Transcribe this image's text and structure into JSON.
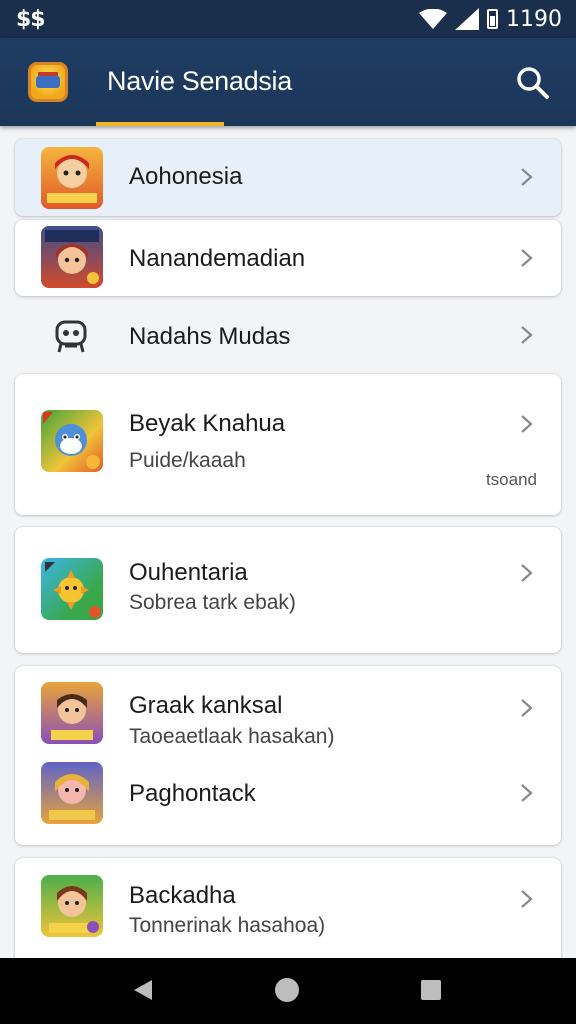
{
  "status_bar": {
    "left_icons": "$$",
    "time": "1190",
    "icons": [
      "wifi-icon",
      "signal-icon",
      "battery-icon"
    ]
  },
  "app_bar": {
    "title": "Navie Senadsia",
    "logo": "game-logo-icon",
    "search": "search-icon",
    "accent": "#f0b429",
    "background": "#1f3d63"
  },
  "items": [
    {
      "title": "Aohonesia",
      "icon": "cartoon-character-icon",
      "style": "highlight"
    },
    {
      "title": "Nanandemadian",
      "icon": "cartoon-character-icon",
      "style": "card"
    },
    {
      "title": "Nadahs Mudas",
      "icon": "robot-outline-icon",
      "style": "plain"
    },
    {
      "title": "Beyak Knahua",
      "subtitle": "Puide/kaaah",
      "badge": "tsoand",
      "icon": "cartoon-fox-icon",
      "style": "card"
    },
    {
      "title": "Ouhentaria",
      "subtitle": "Sobrea tark ebak)",
      "icon": "cartoon-sun-icon",
      "style": "card"
    },
    {
      "title": "Graak kanksal",
      "subtitle": "Taoeaetlaak hasakan)",
      "icon": "cartoon-character-icon",
      "style": "card-group"
    },
    {
      "title": "Paghontack",
      "icon": "cartoon-character-icon",
      "style": "card-group"
    },
    {
      "title": "Backadha",
      "subtitle": "Tonnerinak hasahoa)",
      "icon": "cartoon-character-icon",
      "style": "card"
    }
  ],
  "nav_bar": {
    "icons": [
      "back-icon",
      "home-icon",
      "recents-icon"
    ]
  }
}
